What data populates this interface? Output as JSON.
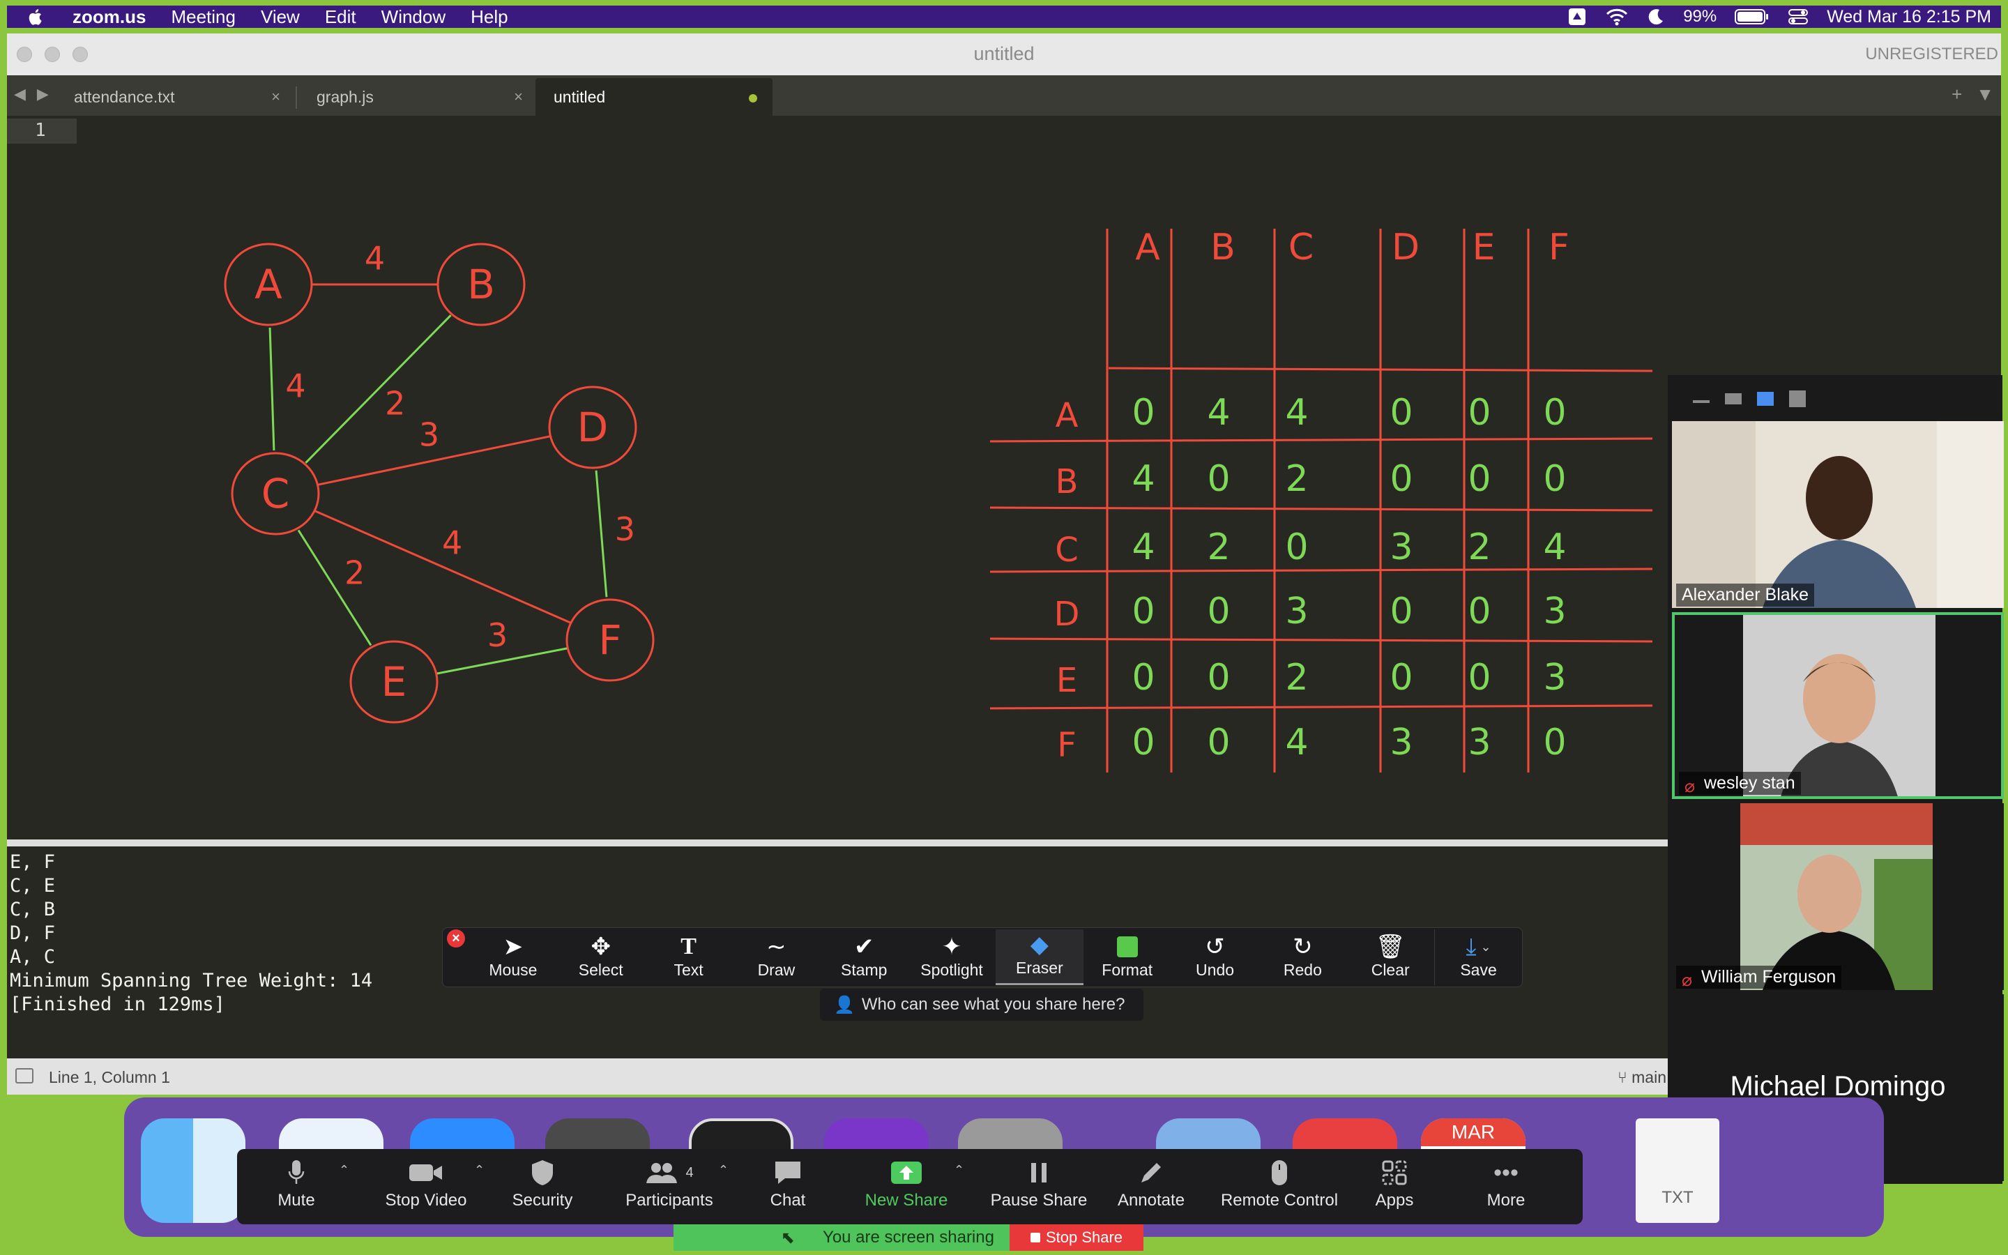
{
  "menubar": {
    "items": [
      "zoom.us",
      "Meeting",
      "View",
      "Edit",
      "Window",
      "Help"
    ],
    "battery": "99%",
    "datetime": "Wed Mar 16  2:15 PM"
  },
  "window": {
    "title": "untitled",
    "registration": "UNREGISTERED",
    "tabs": [
      {
        "label": "attendance.txt",
        "close": "×"
      },
      {
        "label": "graph.js",
        "close": "×"
      },
      {
        "label": "untitled"
      }
    ],
    "line_number": "1"
  },
  "drawing": {
    "graph_nodes": [
      "A",
      "B",
      "C",
      "D",
      "E",
      "F"
    ],
    "edges": [
      {
        "from": "A",
        "to": "B",
        "weight": "4"
      },
      {
        "from": "A",
        "to": "C",
        "weight": "4"
      },
      {
        "from": "B",
        "to": "C",
        "weight": "2"
      },
      {
        "from": "C",
        "to": "D",
        "weight": "3"
      },
      {
        "from": "C",
        "to": "F",
        "weight": "4"
      },
      {
        "from": "C",
        "to": "E",
        "weight": "2"
      },
      {
        "from": "D",
        "to": "F",
        "weight": "3"
      },
      {
        "from": "E",
        "to": "F",
        "weight": "3"
      }
    ],
    "matrix_headers": [
      "A",
      "B",
      "C",
      "D",
      "E",
      "F"
    ],
    "matrix": [
      [
        "0",
        "4",
        "4",
        "0",
        "0",
        "0"
      ],
      [
        "4",
        "0",
        "2",
        "0",
        "0",
        "0"
      ],
      [
        "4",
        "2",
        "0",
        "3",
        "2",
        "4"
      ],
      [
        "0",
        "0",
        "3",
        "0",
        "0",
        "3"
      ],
      [
        "0",
        "0",
        "2",
        "0",
        "0",
        "3"
      ],
      [
        "0",
        "0",
        "4",
        "3",
        "3",
        "0"
      ]
    ],
    "ink_red": "#f04a3a",
    "ink_green": "#7ed957"
  },
  "output": {
    "lines": [
      "E, F",
      "C, E",
      "C, B",
      "D, F",
      "A, C",
      "Minimum Spanning Tree Weight: 14",
      "[Finished in 129ms]"
    ]
  },
  "statusbar": {
    "position": "Line 1, Column 1",
    "branch": "main"
  },
  "annotate": {
    "tools": [
      "Mouse",
      "Select",
      "Text",
      "Draw",
      "Stamp",
      "Spotlight",
      "Eraser",
      "Format",
      "Undo",
      "Redo",
      "Clear",
      "Save"
    ],
    "selected": "Eraser",
    "who_can_see": "Who can see what you share here?"
  },
  "participants": [
    {
      "name": "Alexander Blake",
      "muted": false
    },
    {
      "name": "wesley stan",
      "muted": true,
      "speaking": true
    },
    {
      "name": "William Ferguson",
      "muted": true
    },
    {
      "name": "Michael Domingo",
      "muted": true,
      "video_off": true
    }
  ],
  "dock": {
    "calendar_month": "MAR",
    "txt_label": "TXT"
  },
  "controls": {
    "mute": "Mute",
    "stop_video": "Stop Video",
    "security": "Security",
    "participants": "Participants",
    "participant_count": "4",
    "chat": "Chat",
    "new_share": "New Share",
    "pause_share": "Pause Share",
    "annotate": "Annotate",
    "remote_control": "Remote Control",
    "apps": "Apps",
    "more": "More"
  },
  "share_bar": {
    "text": "You are screen sharing",
    "stop": "Stop Share"
  }
}
